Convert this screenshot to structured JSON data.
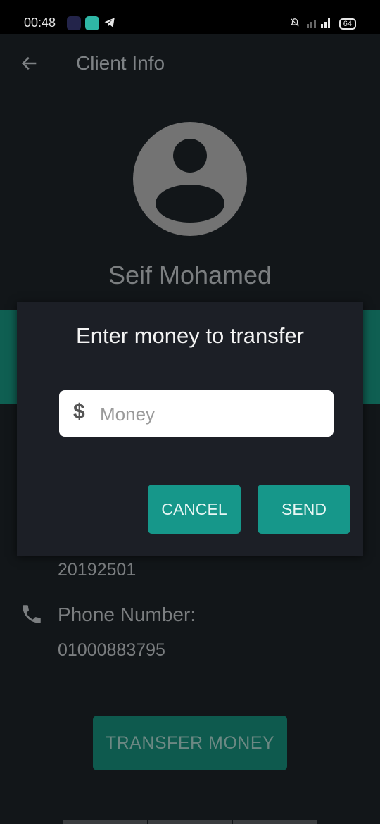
{
  "status_bar": {
    "time": "00:48",
    "battery": "64"
  },
  "app_bar": {
    "title": "Client Info",
    "back_icon": "arrow-left-icon"
  },
  "client": {
    "name": "Seif Mohamed",
    "account_number": "20192501",
    "phone_label": "Phone Number:",
    "phone_number": "01000883795"
  },
  "actions": {
    "transfer_label": "TRANSFER MONEY"
  },
  "dialog": {
    "title": "Enter money to transfer",
    "input_placeholder": "Money",
    "input_value": "",
    "input_icon": "dollar-icon",
    "cancel_label": "CANCEL",
    "send_label": "SEND"
  },
  "colors": {
    "accent": "#16978a",
    "band": "#0f5f52",
    "background": "#121619",
    "dialog": "#1c1f26"
  }
}
